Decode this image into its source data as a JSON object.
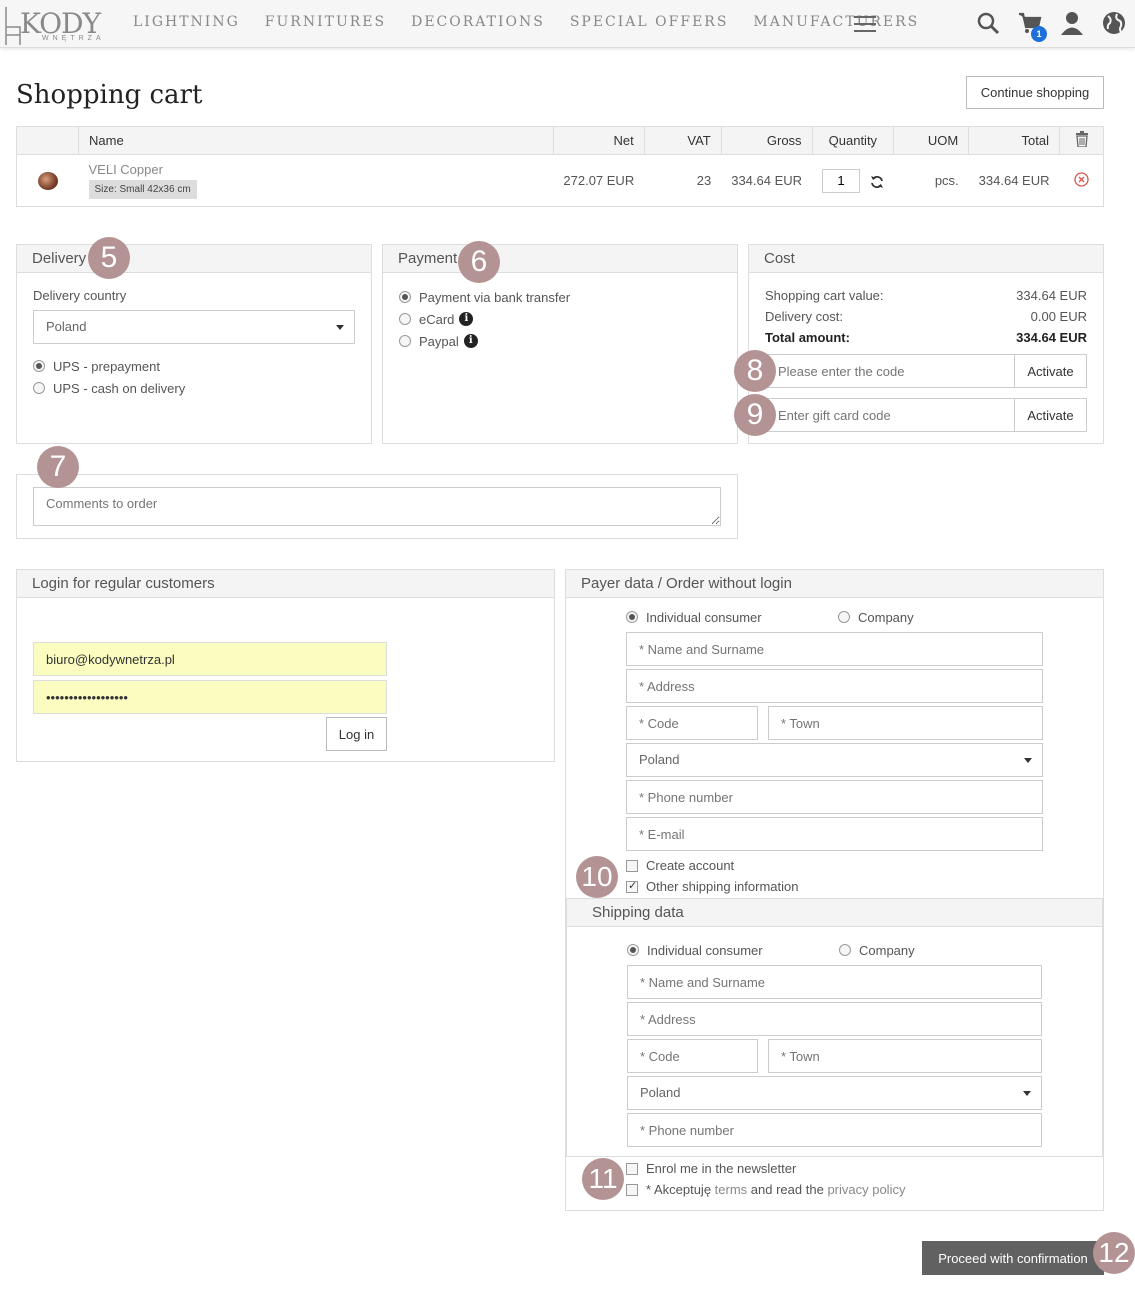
{
  "header": {
    "logo": {
      "text": "KODY",
      "subtitle": "WNĘTRZA"
    },
    "nav": [
      "LIGHTNING",
      "FURNITURES",
      "DECORATIONS",
      "SPECIAL OFFERS",
      "MANUFACTURERS"
    ],
    "cart_count": "1"
  },
  "page": {
    "title": "Shopping cart",
    "continue_label": "Continue shopping"
  },
  "cart": {
    "columns": {
      "name": "Name",
      "net": "Net",
      "vat": "VAT",
      "gross": "Gross",
      "quantity": "Quantity",
      "uom": "UOM",
      "total": "Total"
    },
    "items": [
      {
        "name": "VELI Copper",
        "size": "Size: Small 42x36 cm",
        "net": "272.07 EUR",
        "vat": "23",
        "gross": "334.64 EUR",
        "quantity": "1",
        "uom": "pcs.",
        "total": "334.64 EUR"
      }
    ]
  },
  "delivery": {
    "title": "Delivery",
    "country_label": "Delivery country",
    "country": "Poland",
    "options": [
      {
        "label": "UPS - prepayment",
        "checked": true
      },
      {
        "label": "UPS - cash on delivery",
        "checked": false
      }
    ]
  },
  "payment": {
    "title": "Payment",
    "options": [
      {
        "label": "Payment via bank transfer",
        "checked": true,
        "info": false
      },
      {
        "label": "eCard",
        "checked": false,
        "info": true
      },
      {
        "label": "Paypal",
        "checked": false,
        "info": true
      }
    ]
  },
  "cost": {
    "title": "Cost",
    "cart_value_label": "Shopping cart value:",
    "cart_value": "334.64 EUR",
    "delivery_label": "Delivery cost:",
    "delivery_value": "0.00 EUR",
    "total_label": "Total amount:",
    "total_value": "334.64 EUR",
    "code_placeholder": "Please enter the code",
    "gift_placeholder": "Enter gift card code",
    "activate_label": "Activate"
  },
  "comments": {
    "placeholder": "Comments to order"
  },
  "login": {
    "title": "Login for regular customers",
    "email": "biuro@kodywnetrza.pl",
    "password": "••••••••••••••••••",
    "button": "Log in"
  },
  "payer": {
    "title": "Payer data / Order without login",
    "individual_label": "Individual consumer",
    "company_label": "Company",
    "name_placeholder": "* Name and Surname",
    "address_placeholder": "* Address",
    "code_placeholder": "* Code",
    "town_placeholder": "* Town",
    "country": "Poland",
    "phone_placeholder": "* Phone number",
    "email_placeholder": "* E-mail",
    "create_account_label": "Create account",
    "other_shipping_label": "Other shipping information"
  },
  "shipping": {
    "title": "Shipping data",
    "individual_label": "Individual consumer",
    "company_label": "Company",
    "name_placeholder": "* Name and Surname",
    "address_placeholder": "* Address",
    "code_placeholder": "* Code",
    "town_placeholder": "* Town",
    "country": "Poland",
    "phone_placeholder": "* Phone number"
  },
  "agreements": {
    "newsletter_label": "Enrol me in the newsletter",
    "terms_prefix": "* Akceptuję",
    "terms_link": "terms",
    "terms_mid": "and read the",
    "privacy_link": "privacy policy"
  },
  "proceed_label": "Proceed with confirmation",
  "badges": [
    "5",
    "6",
    "7",
    "8",
    "9",
    "10",
    "11",
    "12"
  ]
}
